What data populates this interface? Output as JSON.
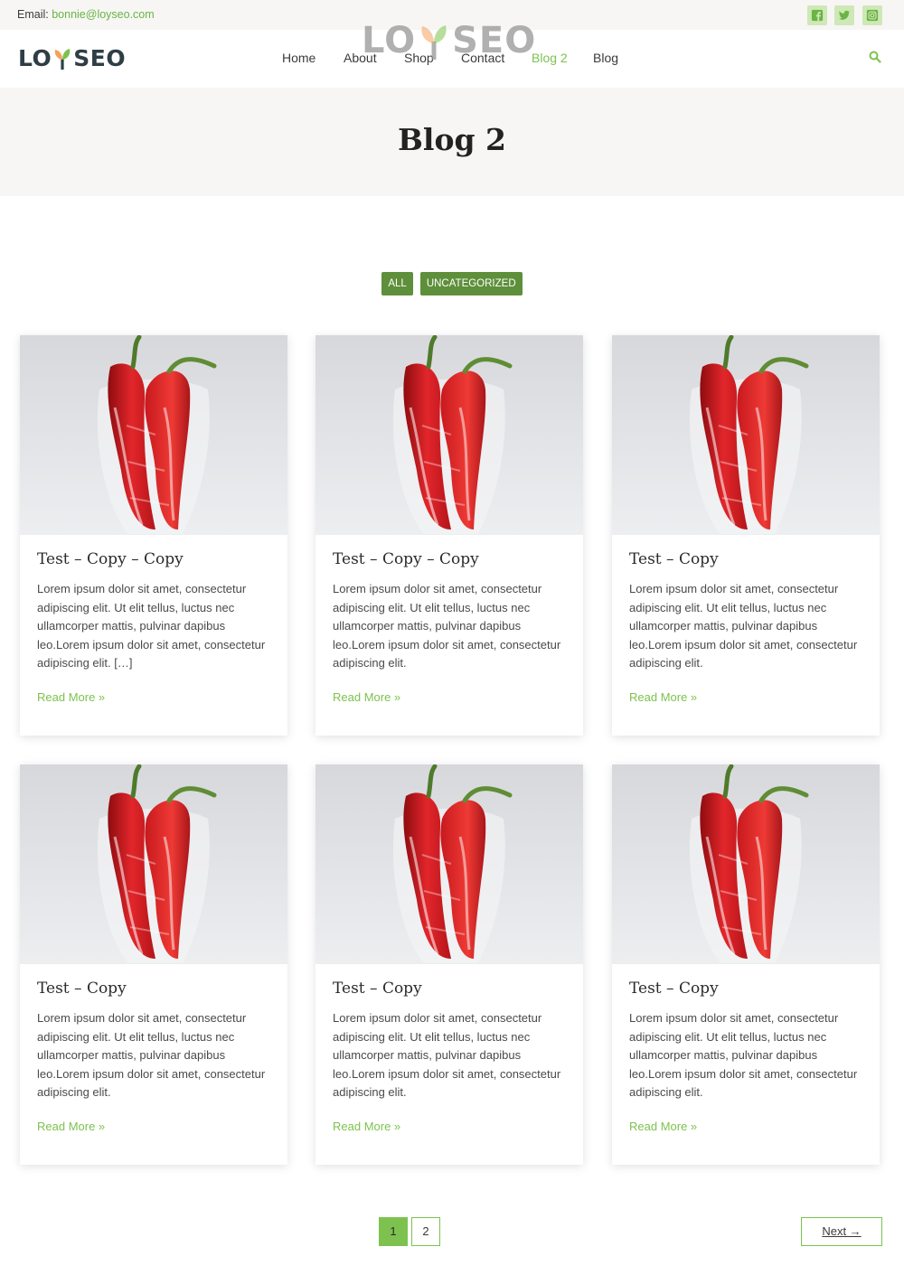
{
  "topbar": {
    "email_label": "Email:",
    "email_value": "bonnie@loyseo.com",
    "social": [
      "facebook-icon",
      "twitter-icon",
      "instagram-icon"
    ]
  },
  "brand": {
    "logo_left": "LO",
    "logo_right": "SEO",
    "watermark_left": "LO",
    "watermark_right": "SEO",
    "accent": "#7dc24f",
    "dark_green": "#5e8f3a"
  },
  "nav": {
    "items": [
      "Home",
      "About",
      "Shop",
      "Contact",
      "Blog 2",
      "Blog"
    ],
    "active": "Blog 2"
  },
  "hero": {
    "title": "Blog 2"
  },
  "filters": [
    "ALL",
    "UNCATEGORIZED"
  ],
  "posts": [
    {
      "title": "Test – Copy – Copy",
      "excerpt": "Lorem ipsum dolor sit amet, consectetur adipiscing elit. Ut elit tellus, luctus nec ullamcorper mattis, pulvinar dapibus leo.Lorem ipsum dolor sit amet, consectetur adipiscing elit. […]",
      "more": "Read More »"
    },
    {
      "title": "Test – Copy – Copy",
      "excerpt": "Lorem ipsum dolor sit amet, consectetur adipiscing elit. Ut elit tellus, luctus nec ullamcorper mattis, pulvinar dapibus leo.Lorem ipsum dolor sit amet, consectetur adipiscing elit.",
      "more": "Read More »"
    },
    {
      "title": "Test – Copy",
      "excerpt": "Lorem ipsum dolor sit amet, consectetur adipiscing elit. Ut elit tellus, luctus nec ullamcorper mattis, pulvinar dapibus leo.Lorem ipsum dolor sit amet, consectetur adipiscing elit.",
      "more": "Read More »"
    },
    {
      "title": "Test – Copy",
      "excerpt": "Lorem ipsum dolor sit amet, consectetur adipiscing elit. Ut elit tellus, luctus nec ullamcorper mattis, pulvinar dapibus leo.Lorem ipsum dolor sit amet, consectetur adipiscing elit.",
      "more": "Read More »"
    },
    {
      "title": "Test – Copy",
      "excerpt": "Lorem ipsum dolor sit amet, consectetur adipiscing elit. Ut elit tellus, luctus nec ullamcorper mattis, pulvinar dapibus leo.Lorem ipsum dolor sit amet, consectetur adipiscing elit.",
      "more": "Read More »"
    },
    {
      "title": "Test – Copy",
      "excerpt": "Lorem ipsum dolor sit amet, consectetur adipiscing elit. Ut elit tellus, luctus nec ullamcorper mattis, pulvinar dapibus leo.Lorem ipsum dolor sit amet, consectetur adipiscing elit.",
      "more": "Read More »"
    }
  ],
  "pagination": {
    "pages": [
      "1",
      "2"
    ],
    "current": "1",
    "next_label": "Next →"
  }
}
